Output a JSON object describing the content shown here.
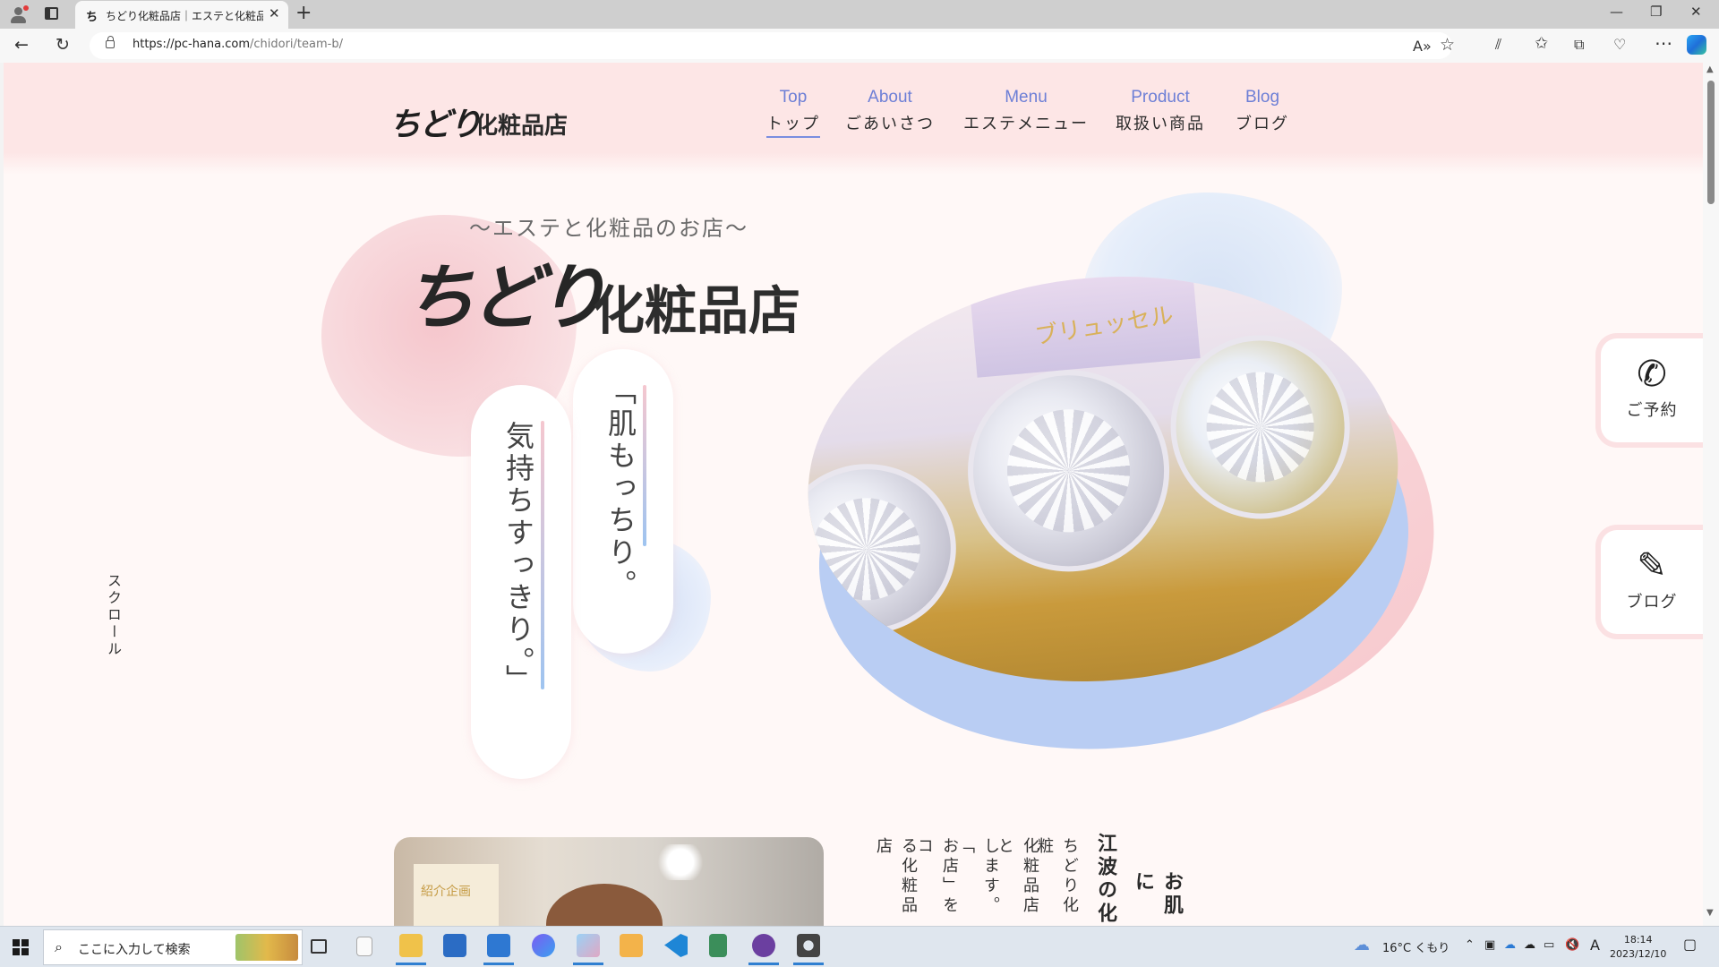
{
  "browser": {
    "tab_title": "ちどり化粧品店｜エステと化粧品のお",
    "tab_favicon": "ち",
    "new_tab": "+",
    "tab_close": "✕",
    "url_host": "https://pc-hana.com",
    "url_path": "/chidori/team-b/",
    "window_controls": {
      "minimize": "—",
      "restore": "❐",
      "close": "✕"
    },
    "nav": {
      "back": "←",
      "reload": "↻"
    },
    "tools": [
      "A»",
      "☆",
      "⫽",
      "✩",
      "⧉",
      "♡",
      "⋯"
    ]
  },
  "site": {
    "logo_mark": "ちどり",
    "logo_text": "化粧品店",
    "menu": [
      {
        "en": "Top",
        "jp": "トップ",
        "active": true
      },
      {
        "en": "About",
        "jp": "ごあいさつ"
      },
      {
        "en": "Menu",
        "jp": "エステメニュー"
      },
      {
        "en": "Product",
        "jp": "取扱い商品"
      },
      {
        "en": "Blog",
        "jp": "ブログ"
      }
    ]
  },
  "hero": {
    "tagline": "〜エステと化粧品のお店〜",
    "logo_mark": "ちどり",
    "logo_text": "化粧品店",
    "catch1": "「肌もっちり。",
    "catch2": "気持ちすっきり。」",
    "photo_label": "ブリュッセル"
  },
  "floating": {
    "reserve": {
      "icon": "phone-icon",
      "glyph": "✆",
      "label": "ご予約"
    },
    "blog": {
      "icon": "notepad-pen-icon",
      "glyph": "✎",
      "label": "ブログ"
    }
  },
  "scroll_label": "スクロール",
  "about": {
    "poster_text": "紹介企画",
    "heading1": "お肌に",
    "heading2": "江波の化",
    "columns": [
      "ちどり化粧",
      "化粧品店と",
      "します。「",
      "お店」をコ",
      "る化粧品店"
    ]
  },
  "taskbar": {
    "search_placeholder": "ここに入力して検索",
    "weather": "16°C くもり",
    "time": "18:14",
    "date": "2023/12/10",
    "ime": "A"
  },
  "colors": {
    "header_pink": "#fde6e6",
    "menu_blue": "#6d7fd6",
    "page_bg": "#fff8f7"
  }
}
